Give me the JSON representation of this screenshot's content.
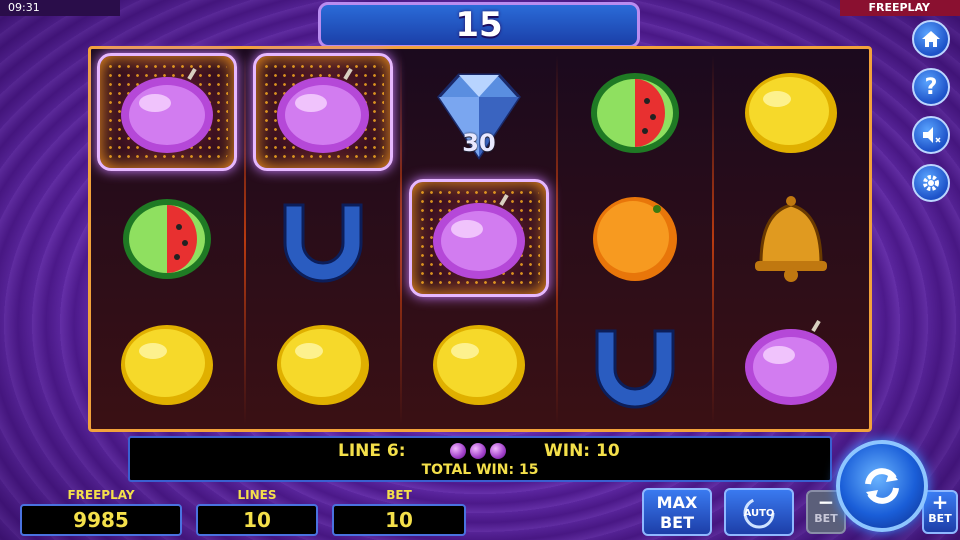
{
  "status": {
    "time": "09:31",
    "mode": "FREEPLAY"
  },
  "banner": {
    "win_amount": "15"
  },
  "reels": {
    "grid": [
      [
        "plum",
        "plum",
        "diamond",
        "watermelon",
        "lemon"
      ],
      [
        "watermelon",
        "horseshoe",
        "plum",
        "orange",
        "bell"
      ],
      [
        "lemon",
        "lemon",
        "lemon",
        "horseshoe",
        "plum"
      ]
    ],
    "highlighted": [
      [
        0,
        0
      ],
      [
        0,
        1
      ],
      [
        1,
        2
      ]
    ],
    "diamond_value": "30"
  },
  "win_info": {
    "line_label": "LINE 6:",
    "line_symbol_icon": "plum-icon",
    "win_label": "WIN: 10",
    "total_label": "TOTAL WIN: 15"
  },
  "stats": {
    "freeplay_label": "FREEPLAY",
    "freeplay_value": "9985",
    "lines_label": "LINES",
    "lines_value": "10",
    "bet_label": "BET",
    "bet_value": "10"
  },
  "buttons": {
    "max_bet_top": "MAX",
    "max_bet_bottom": "BET",
    "auto_label": "AUTO",
    "bet_minus_label": "BET",
    "bet_plus_label": "BET",
    "help": "?"
  },
  "colors": {
    "accent_yellow": "#f4e04a",
    "frame_orange": "#f2a23b",
    "button_blue": "#2a6bd8"
  }
}
